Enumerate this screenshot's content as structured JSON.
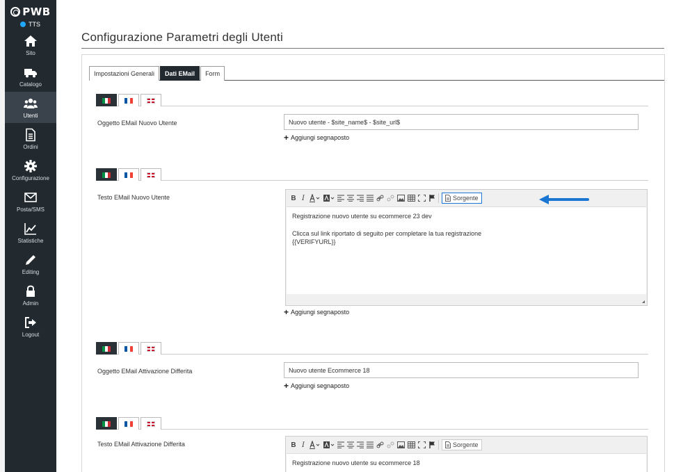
{
  "sidebar": {
    "logo_text": "PWB",
    "env_label": "TTS",
    "items": [
      {
        "label": "Sito",
        "icon": "home-icon"
      },
      {
        "label": "Catalogo",
        "icon": "truck-icon"
      },
      {
        "label": "Utenti",
        "icon": "users-icon"
      },
      {
        "label": "Ordini",
        "icon": "document-icon"
      },
      {
        "label": "Configurazione",
        "icon": "gear-icon"
      },
      {
        "label": "Posta/SMS",
        "icon": "envelope-icon"
      },
      {
        "label": "Statistiche",
        "icon": "chart-icon"
      },
      {
        "label": "Editing",
        "icon": "pencil-icon"
      },
      {
        "label": "Admin",
        "icon": "lock-icon"
      },
      {
        "label": "Logout",
        "icon": "logout-icon"
      }
    ]
  },
  "page": {
    "title": "Configurazione Parametri degli Utenti"
  },
  "tabs": [
    {
      "label": "Impostazioni Generali"
    },
    {
      "label": "Dati EMail"
    },
    {
      "label": "Form"
    }
  ],
  "languages": [
    "italian-flag-icon",
    "french-flag-icon",
    "uk-flag-icon"
  ],
  "fields": {
    "f1": {
      "label": "Oggetto EMail Nuovo Utente",
      "value": "Nuovo utente - $site_name$ - $site_url$"
    },
    "f2": {
      "label": "Testo EMail Nuovo Utente",
      "line1": "Registrazione nuovo utente su ecommerce 23 dev",
      "line2": "Clicca sul link riportato di seguito per completare la tua registrazione",
      "line3": "{{VERIFYURL}}"
    },
    "f3": {
      "label": "Oggetto EMail Attivazione Differita",
      "value": "Nuovo utente Ecommerce 18"
    },
    "f4": {
      "label": "Testo EMail Attivazione Differita",
      "line1": "Registrazione nuovo utente su ecommerce 18"
    }
  },
  "add_placeholder_label": "Aggiungi segnaposto",
  "editor": {
    "bold": "B",
    "italic": "I",
    "source_label": "Sorgente"
  },
  "colors": {
    "sidebar_bg": "#222a30",
    "highlight": "#1976d2"
  }
}
